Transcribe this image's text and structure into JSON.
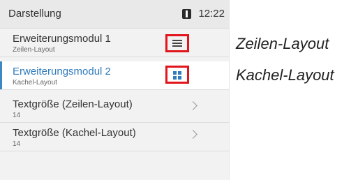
{
  "header": {
    "title": "Darstellung",
    "time": "12:22",
    "icon": "sd-card-icon"
  },
  "items": [
    {
      "title": "Erweiterungsmodul 1",
      "subtitle": "Zeilen-Layout",
      "layout_icon": "list-lines-icon"
    },
    {
      "title": "Erweiterungsmodul 2",
      "subtitle": "Kachel-Layout",
      "layout_icon": "tile-grid-icon"
    },
    {
      "title": "Textgröße (Zeilen-Layout)",
      "subtitle": "14"
    },
    {
      "title": "Textgröße (Kachel-Layout)",
      "subtitle": "14"
    }
  ],
  "annotations": {
    "zeilen": "Zeilen-Layout",
    "kachel": "Kachel-Layout"
  },
  "colors": {
    "accent": "#2f7bbd",
    "highlight_box": "#e2141c"
  }
}
